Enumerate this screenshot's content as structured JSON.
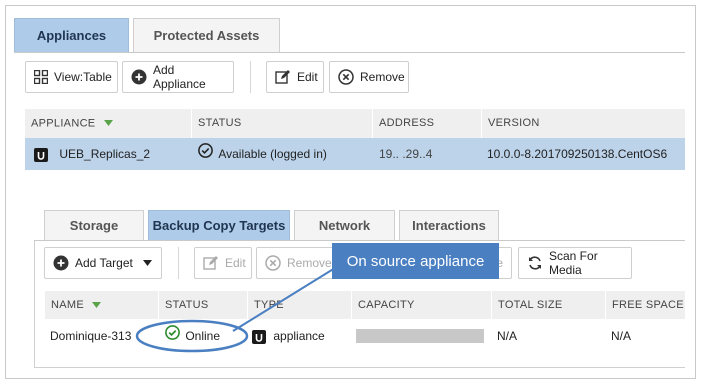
{
  "top_tabs": [
    {
      "label": "Appliances",
      "active": true
    },
    {
      "label": "Protected Assets",
      "active": false
    }
  ],
  "toolbar": {
    "view_table": "View:Table",
    "add_appliance": "Add Appliance",
    "edit": "Edit",
    "remove": "Remove"
  },
  "appliances_table": {
    "columns": [
      "APPLIANCE",
      "STATUS",
      "ADDRESS",
      "VERSION"
    ],
    "rows": [
      {
        "appliance": "UEB_Replicas_2",
        "status": "Available (logged in)",
        "address": "19..  .29..4",
        "version": "10.0.0-8.201709250138.CentOS6",
        "selected": true
      }
    ]
  },
  "sub_tabs": [
    {
      "label": "Storage",
      "active": false
    },
    {
      "label": "Backup Copy Targets",
      "active": true
    },
    {
      "label": "Network",
      "active": false
    },
    {
      "label": "Interactions",
      "active": false
    }
  ],
  "sub_toolbar": {
    "add_target": "Add Target",
    "edit": "Edit",
    "remove": "Remove",
    "hidden_suffix": "e",
    "scan_for_media": "Scan For Media"
  },
  "targets_table": {
    "columns": [
      "NAME",
      "STATUS",
      "TYPE",
      "CAPACITY",
      "TOTAL SIZE",
      "FREE SPACE"
    ],
    "rows": [
      {
        "name": "Dominique-313",
        "status": "Online",
        "type": "appliance",
        "capacity": "",
        "total_size": "N/A",
        "free_space": "N/A"
      }
    ]
  },
  "callout": {
    "text": "On source appliance"
  },
  "colors": {
    "accent": "#4a7fc1",
    "selected_row": "#bcd3ea",
    "active_tab": "#aecbe9",
    "online_green": "#2e8b2e",
    "sort_arrow": "#5aa34a"
  }
}
